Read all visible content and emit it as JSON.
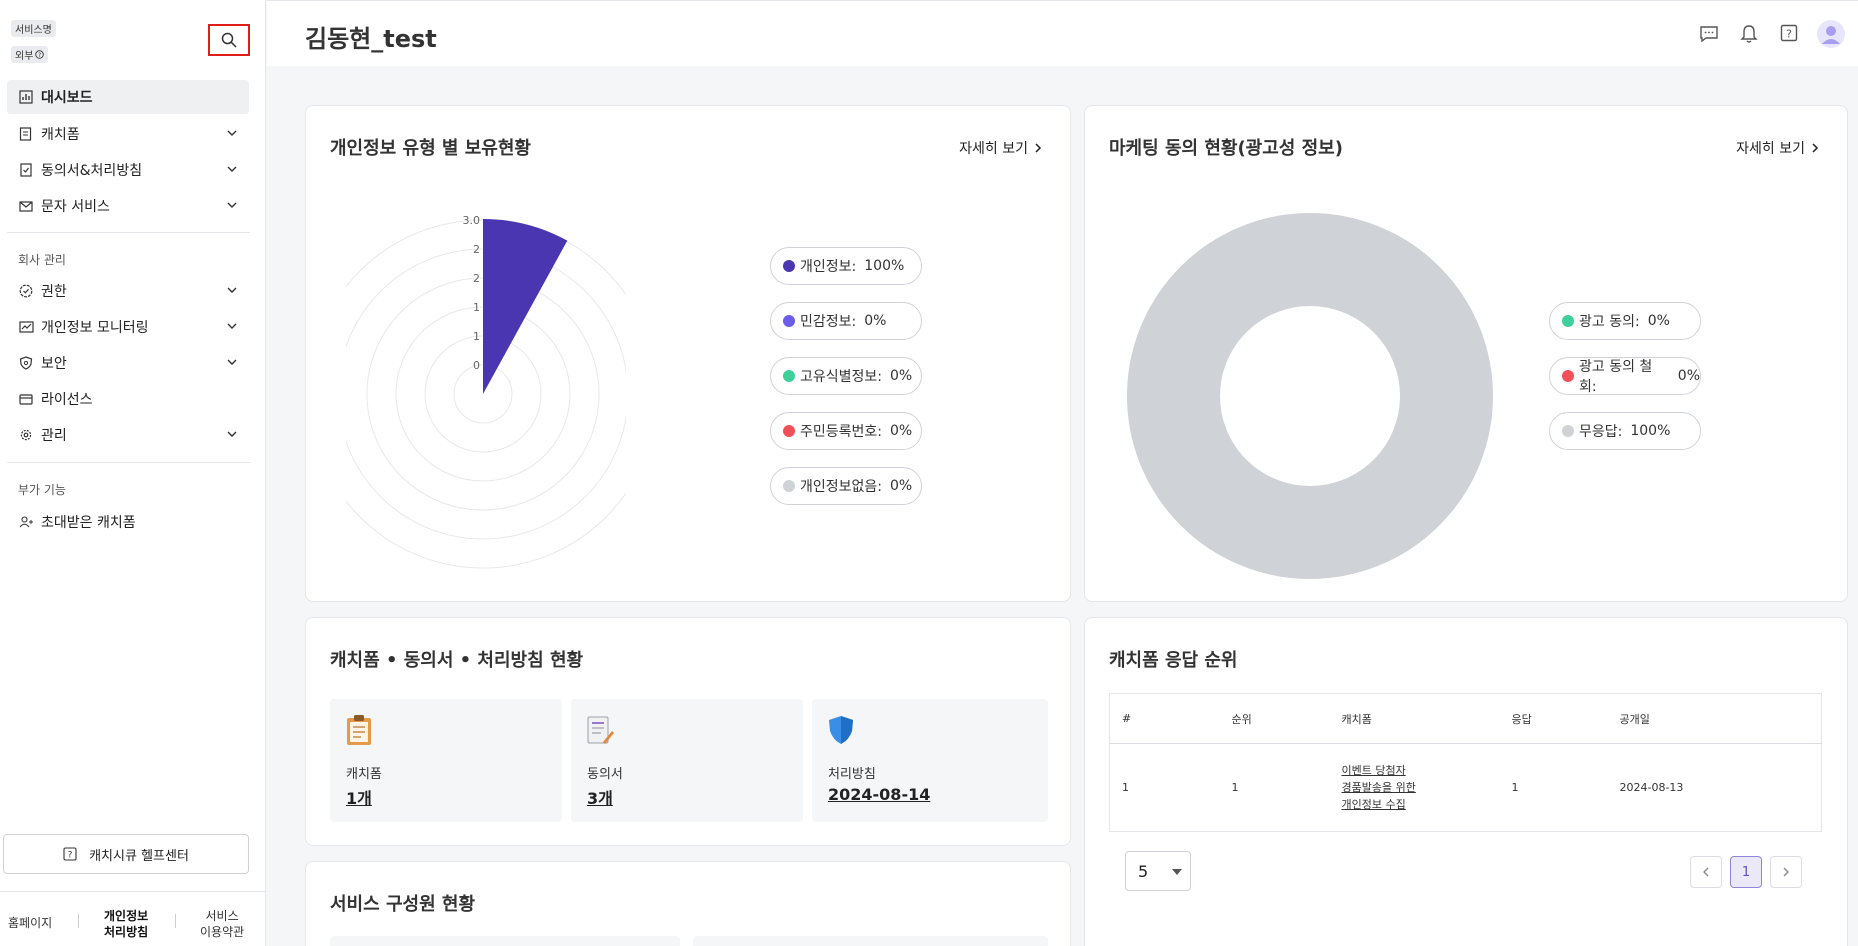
{
  "sidebar": {
    "badges": {
      "service_name": "서비스명",
      "external": "외부"
    },
    "items": [
      {
        "label": "대시보드"
      },
      {
        "label": "캐치폼"
      },
      {
        "label": "동의서&처리방침"
      },
      {
        "label": "문자 서비스"
      },
      {
        "label": "권한"
      },
      {
        "label": "개인정보 모니터링"
      },
      {
        "label": "보안"
      },
      {
        "label": "라이선스"
      },
      {
        "label": "관리"
      },
      {
        "label": "초대받은 캐치폼"
      }
    ],
    "sections": {
      "company": "회사 관리",
      "addon": "부가 기능"
    },
    "help_center": "캐치시큐 헬프센터",
    "footer": {
      "home": "홈페이지",
      "privacy_line1": "개인정보",
      "privacy_line2": "처리방침",
      "terms_line1": "서비스",
      "terms_line2": "이용약관"
    }
  },
  "header": {
    "title": "김동현_test"
  },
  "privacy_card": {
    "title": "개인정보 유형 별 보유현황",
    "more": "자세히 보기",
    "axis_ticks": [
      "3.0",
      "2",
      "2",
      "1",
      "1",
      "0"
    ],
    "legend": [
      {
        "label": "개인정보:",
        "value": "100%",
        "color": "#4a36b0"
      },
      {
        "label": "민감정보:",
        "value": "0%",
        "color": "#6c5ce7"
      },
      {
        "label": "고유식별정보:",
        "value": "0%",
        "color": "#3ecf9a"
      },
      {
        "label": "주민등록번호:",
        "value": "0%",
        "color": "#f0505a"
      },
      {
        "label": "개인정보없음:",
        "value": "0%",
        "color": "#cfd2d6"
      }
    ]
  },
  "marketing_card": {
    "title": "마케팅 동의 현황(광고성 정보)",
    "more": "자세히 보기",
    "legend": [
      {
        "label": "광고 동의:",
        "value": "0%",
        "color": "#3ecf9a"
      },
      {
        "label": "광고 동의 철회:",
        "value": "0%",
        "color": "#f0505a"
      },
      {
        "label": "무응답:",
        "value": "100%",
        "color": "#cfd2d6"
      }
    ]
  },
  "status_card": {
    "title": "캐치폼 • 동의서 • 처리방침 현황",
    "boxes": [
      {
        "label": "캐치폼",
        "value": "1개"
      },
      {
        "label": "동의서",
        "value": "3개"
      },
      {
        "label": "처리방침",
        "value": "2024-08-14"
      }
    ]
  },
  "ranking_card": {
    "title": "캐치폼 응답 순위",
    "columns": [
      "#",
      "순위",
      "캐치폼",
      "응답",
      "공개일"
    ],
    "rows": [
      {
        "no": "1",
        "rank": "1",
        "form_line1": "이벤트 당첨자",
        "form_line2": "경품발송을 위한",
        "form_line3": "개인정보 수집",
        "responses": "1",
        "date": "2024-08-13"
      }
    ],
    "page_size": "5",
    "current_page": "1"
  },
  "members_card": {
    "title": "서비스 구성원 현황"
  },
  "chart_data": [
    {
      "type": "polar-area",
      "categories": [
        "개인정보",
        "민감정보",
        "고유식별정보",
        "주민등록번호",
        "개인정보없음"
      ],
      "values": [
        100,
        0,
        0,
        0,
        0
      ],
      "axis_ticks": [
        "0",
        "1",
        "1",
        "2",
        "2",
        "3.0"
      ]
    },
    {
      "type": "pie",
      "categories": [
        "광고 동의",
        "광고 동의 철회",
        "무응답"
      ],
      "values": [
        0,
        0,
        100
      ]
    }
  ]
}
